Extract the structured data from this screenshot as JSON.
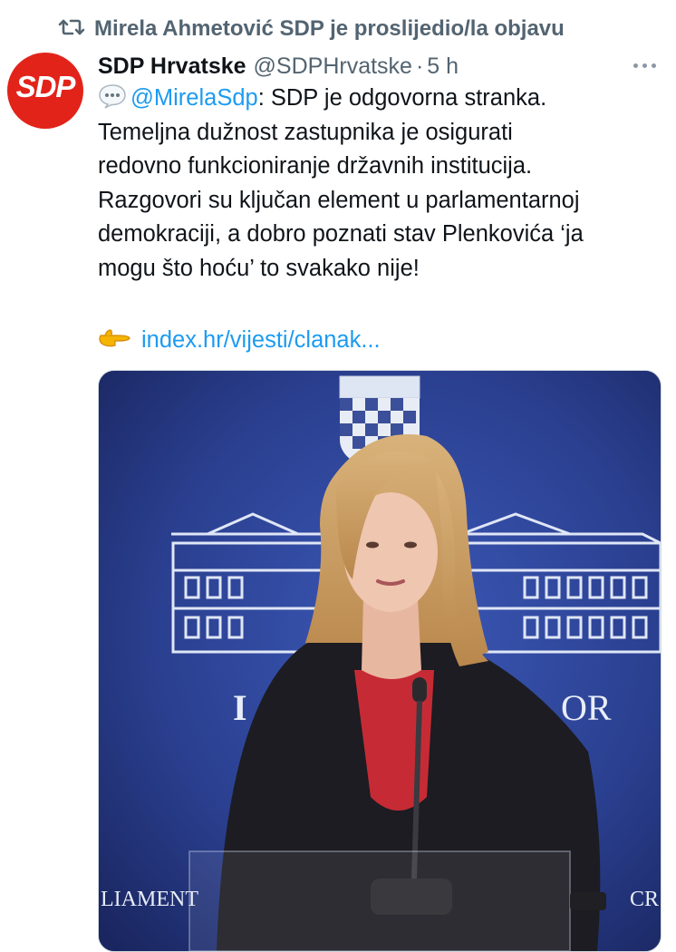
{
  "retweet": {
    "icon": "retweet-icon",
    "label": "Mirela Ahmetović SDP je proslijedio/la objavu"
  },
  "author": {
    "avatar_text": "SDP",
    "avatar_color": "#e2231a",
    "name": "SDP Hrvatske",
    "handle": "@SDPHrvatske",
    "separator": "·",
    "time": "5 h"
  },
  "tweet": {
    "emoji_icon": "speech-balloon-icon",
    "mention": "@MirelaSdp",
    "lines": [
      ": SDP je odgovorna stranka.",
      "Temeljna dužnost zastupnika je osigurati",
      "redovno funkcioniranje državnih institucija.",
      "Razgovori su ključan element u parlamentarnoj",
      "demokraciji, a dobro poznati stav Plenkovića ‘ja",
      "mogu što hoću’ to svakako nije!"
    ],
    "link_emoji_icon": "pointing-hand-icon",
    "link_text": "index.hr/vijesti/clanak..."
  },
  "media": {
    "type": "photo",
    "backdrop_text_left": "LIAMENT",
    "backdrop_text_right": "CR",
    "backdrop_text_mid": "OR",
    "backdrop_text_mid_left": "I"
  },
  "colors": {
    "accent": "#1d9bf0",
    "muted": "#536471",
    "text": "#0f1419",
    "brand_red": "#e2231a"
  }
}
